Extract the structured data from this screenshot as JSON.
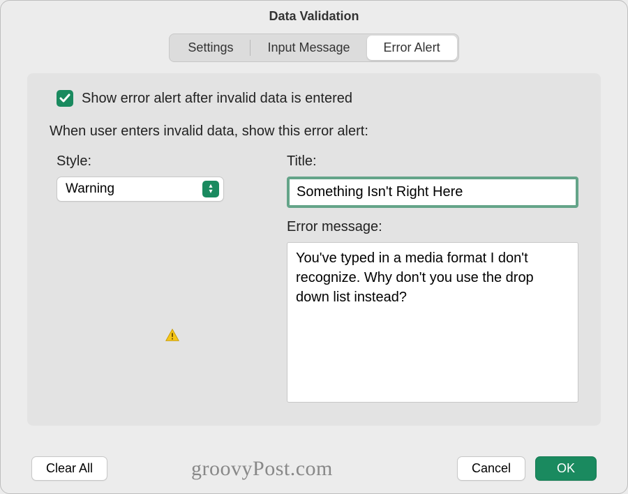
{
  "window": {
    "title": "Data Validation"
  },
  "tabs": {
    "settings": "Settings",
    "input_message": "Input Message",
    "error_alert": "Error Alert",
    "active": "error_alert"
  },
  "checkbox": {
    "checked": true,
    "label": "Show error alert after invalid data is entered"
  },
  "instruction": "When user enters invalid data, show this error alert:",
  "style": {
    "label": "Style:",
    "value": "Warning"
  },
  "title_field": {
    "label": "Title:",
    "value": "Something Isn't Right Here"
  },
  "error_message": {
    "label": "Error message:",
    "value": "You've typed in a media format I don't recognize. Why don't you use the drop down list instead?"
  },
  "buttons": {
    "clear_all": "Clear All",
    "cancel": "Cancel",
    "ok": "OK"
  },
  "watermark": "groovyPost.com",
  "colors": {
    "accent": "#1a8a5f"
  }
}
